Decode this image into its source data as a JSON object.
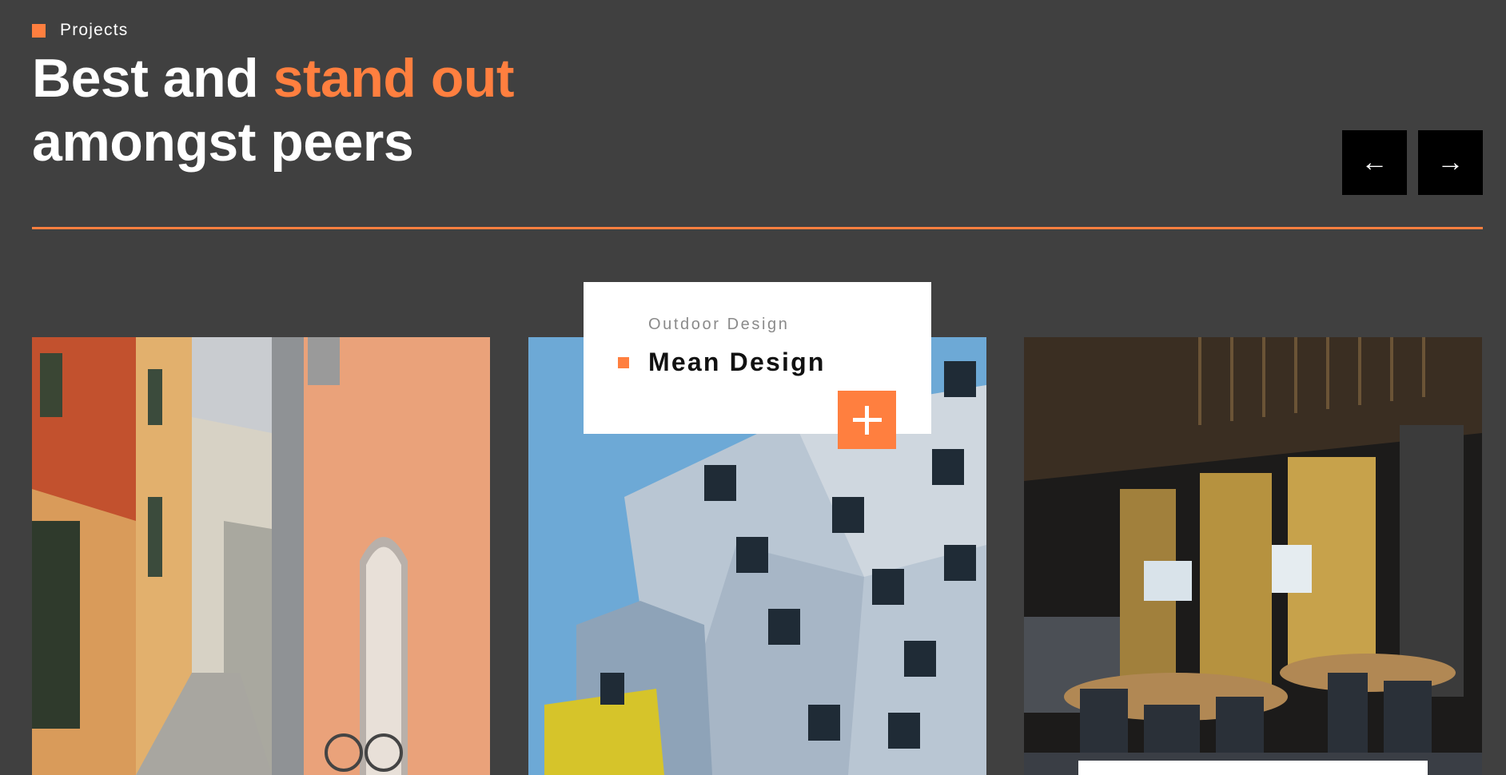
{
  "header": {
    "eyebrow": "Projects",
    "title_part1": "Best and ",
    "title_accent": "stand out",
    "title_line2": "amongst peers"
  },
  "navigation": {
    "prev_symbol": "←",
    "next_symbol": "→"
  },
  "featured": {
    "category": "Outdoor Design",
    "name": "Mean Design"
  },
  "projects": [
    {
      "image": "alley-street-photo"
    },
    {
      "image": "modern-building-photo"
    },
    {
      "image": "restaurant-interior-photo"
    }
  ],
  "colors": {
    "background": "#404040",
    "accent": "#ff7f3f",
    "nav_button": "#000000"
  },
  "icons": {
    "eyebrow_marker": "square-marker-icon",
    "prev": "arrow-left-icon",
    "next": "arrow-right-icon",
    "expand": "plus-icon"
  }
}
